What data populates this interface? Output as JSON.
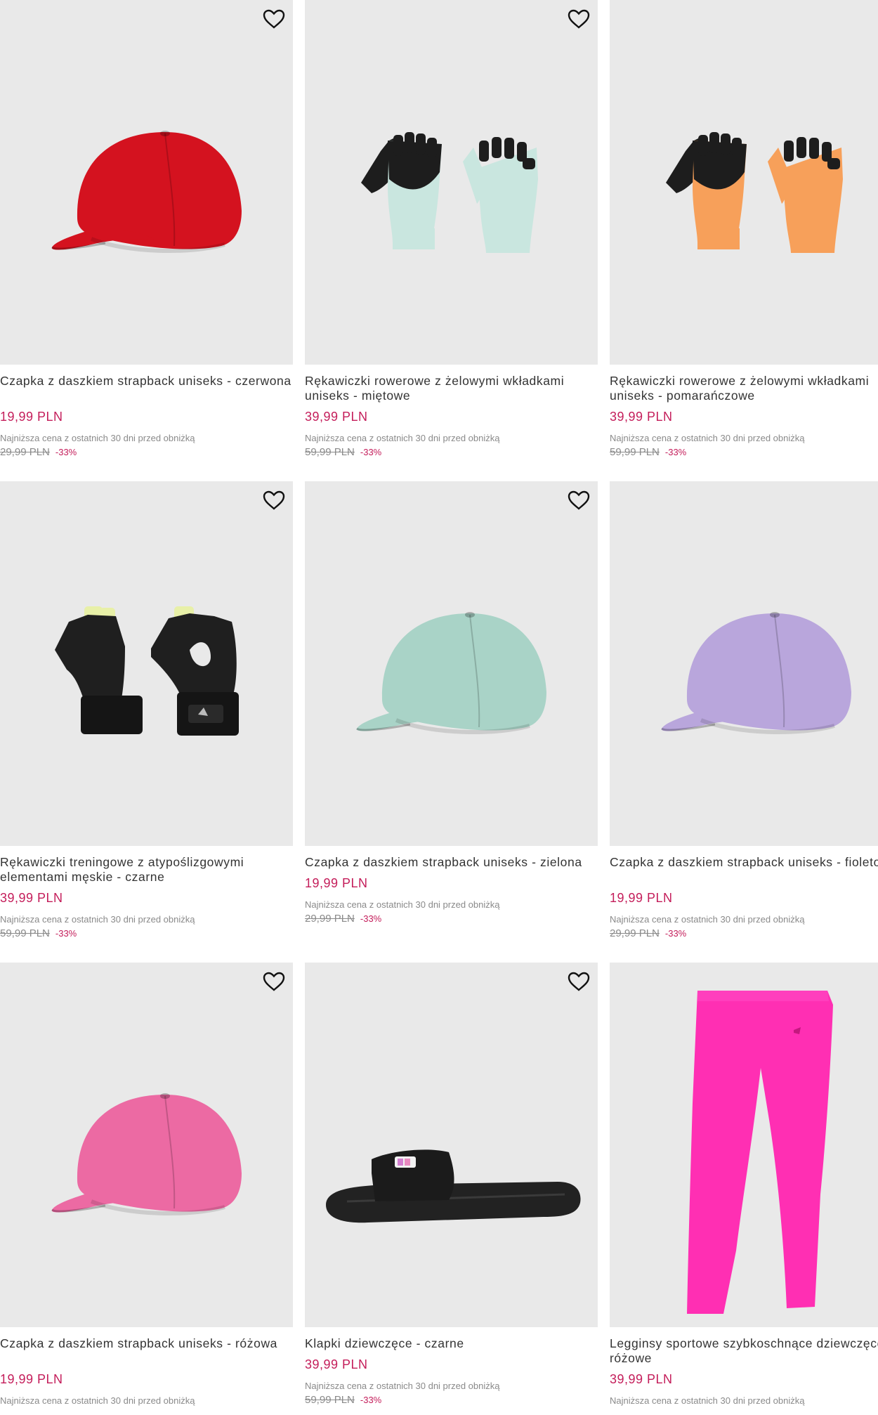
{
  "products": [
    {
      "title": "Czapka z daszkiem strapback uniseks - czerwona",
      "price": "19,99 PLN",
      "lowest_label": "Najniższa cena z ostatnich 30 dni przed obniżką",
      "old_price": "29,99 PLN",
      "discount": "-33%",
      "image": "red-cap"
    },
    {
      "title": "Rękawiczki rowerowe z żelowymi wkładkami uniseks - miętowe",
      "price": "39,99 PLN",
      "lowest_label": "Najniższa cena z ostatnich 30 dni przed obniżką",
      "old_price": "59,99 PLN",
      "discount": "-33%",
      "image": "mint-gloves"
    },
    {
      "title": "Rękawiczki rowerowe z żelowymi wkładkami uniseks - pomarańczowe",
      "price": "39,99 PLN",
      "lowest_label": "Najniższa cena z ostatnich 30 dni przed obniżką",
      "old_price": "59,99 PLN",
      "discount": "-33%",
      "image": "orange-gloves"
    },
    {
      "title": "Rękawiczki treningowe z atypoślizgowymi elementami męskie - czarne",
      "price": "39,99 PLN",
      "lowest_label": "Najniższa cena z ostatnich 30 dni przed obniżką",
      "old_price": "59,99 PLN",
      "discount": "-33%",
      "image": "black-training-gloves"
    },
    {
      "title": "Czapka z daszkiem strapback uniseks - zielona",
      "price": "19,99 PLN",
      "lowest_label": "Najniższa cena z ostatnich 30 dni przed obniżką",
      "old_price": "29,99 PLN",
      "discount": "-33%",
      "image": "green-cap"
    },
    {
      "title": "Czapka z daszkiem strapback uniseks - fioletowa",
      "price": "19,99 PLN",
      "lowest_label": "Najniższa cena z ostatnich 30 dni przed obniżką",
      "old_price": "29,99 PLN",
      "discount": "-33%",
      "image": "purple-cap"
    },
    {
      "title": "Czapka z daszkiem strapback uniseks - różowa",
      "price": "19,99 PLN",
      "lowest_label": "Najniższa cena z ostatnich 30 dni przed obniżką",
      "old_price": "",
      "discount": "",
      "image": "pink-cap"
    },
    {
      "title": "Klapki dziewczęce - czarne",
      "price": "39,99 PLN",
      "lowest_label": "Najniższa cena z ostatnich 30 dni przed obniżką",
      "old_price": "59,99 PLN",
      "discount": "-33%",
      "image": "black-slides"
    },
    {
      "title": "Legginsy sportowe szybkoschnące dziewczęce - różowe",
      "price": "39,99 PLN",
      "lowest_label": "Najniższa cena z ostatnich 30 dni przed obniżką",
      "old_price": "",
      "discount": "",
      "image": "pink-leggings"
    }
  ],
  "colors": {
    "price": "#c41d5a",
    "image_bg": "#e9e9e9"
  },
  "icons": {
    "favorite": "heart-outline-icon"
  }
}
